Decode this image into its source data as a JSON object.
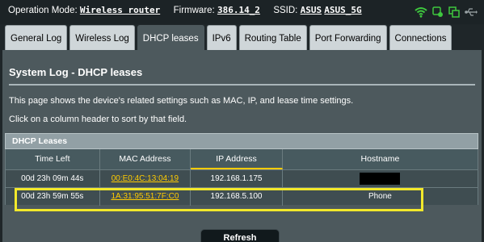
{
  "status_bar": {
    "mode_label": "Operation Mode:",
    "mode_value": "Wireless router",
    "firmware_label": "Firmware:",
    "firmware_value": "386.14_2",
    "ssid_label": "SSID:",
    "ssid_values": [
      "ASUS",
      "ASUS_5G"
    ],
    "icons": [
      "wifi-icon",
      "signal-icon",
      "copy-icon",
      "usb-icon"
    ]
  },
  "tabs": [
    {
      "label": "General Log",
      "active": false
    },
    {
      "label": "Wireless Log",
      "active": false
    },
    {
      "label": "DHCP leases",
      "active": true
    },
    {
      "label": "IPv6",
      "active": false
    },
    {
      "label": "Routing Table",
      "active": false
    },
    {
      "label": "Port Forwarding",
      "active": false
    },
    {
      "label": "Connections",
      "active": false
    }
  ],
  "page": {
    "title": "System Log - DHCP leases",
    "description": "This page shows the device's related settings such as MAC, IP, and lease time settings.",
    "hint": "Click on a column header to sort by that field."
  },
  "table": {
    "title": "DHCP Leases",
    "columns": [
      "Time Left",
      "MAC Address",
      "IP Address",
      "Hostname"
    ],
    "rows": [
      {
        "time_left": "00d 23h 09m 44s",
        "mac": "00:E0:4C:13:04:19",
        "ip": "192.168.1.175",
        "hostname": ""
      },
      {
        "time_left": "00d 23h 59m 55s",
        "mac": "1A:31:95:51:7F:C0",
        "ip": "192.168.5.100",
        "hostname": "Phone"
      }
    ]
  },
  "refresh_label": "Refresh",
  "colors": {
    "panel": "#4d595d",
    "accent_link": "#ffcc00",
    "highlight": "#f2e82b",
    "wifi_icon": "#3ec83e"
  }
}
